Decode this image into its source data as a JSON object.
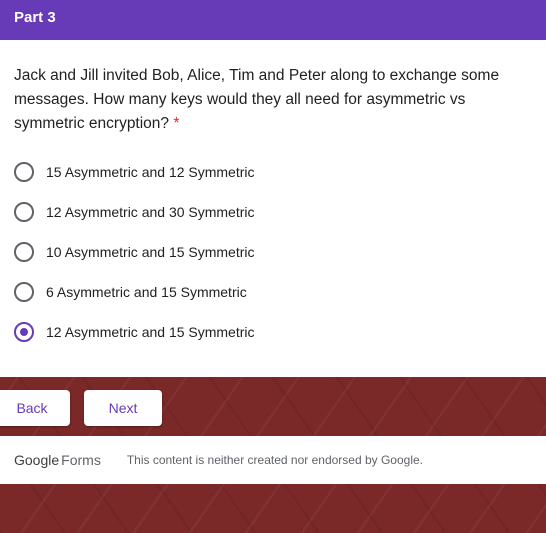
{
  "section": {
    "title": "Part 3"
  },
  "question": {
    "text": "Jack and Jill invited Bob, Alice, Tim and Peter along to exchange some messages. How many keys would they all need for asymmetric vs symmetric encryption?",
    "required_mark": "*",
    "options": [
      {
        "label": "15 Asymmetric and 12 Symmetric",
        "selected": false
      },
      {
        "label": "12 Asymmetric and 30 Symmetric",
        "selected": false
      },
      {
        "label": "10 Asymmetric and 15 Symmetric",
        "selected": false
      },
      {
        "label": "6 Asymmetric and 15 Symmetric",
        "selected": false
      },
      {
        "label": "12 Asymmetric and 15 Symmetric",
        "selected": true
      }
    ]
  },
  "navigation": {
    "back_label": "Back",
    "next_label": "Next"
  },
  "footer": {
    "logo_google": "Google",
    "logo_forms": "Forms",
    "disclaimer": "This content is neither created nor endorsed by Google."
  },
  "colors": {
    "accent": "#673ab7",
    "background": "#7a2828",
    "required": "#d93025"
  }
}
